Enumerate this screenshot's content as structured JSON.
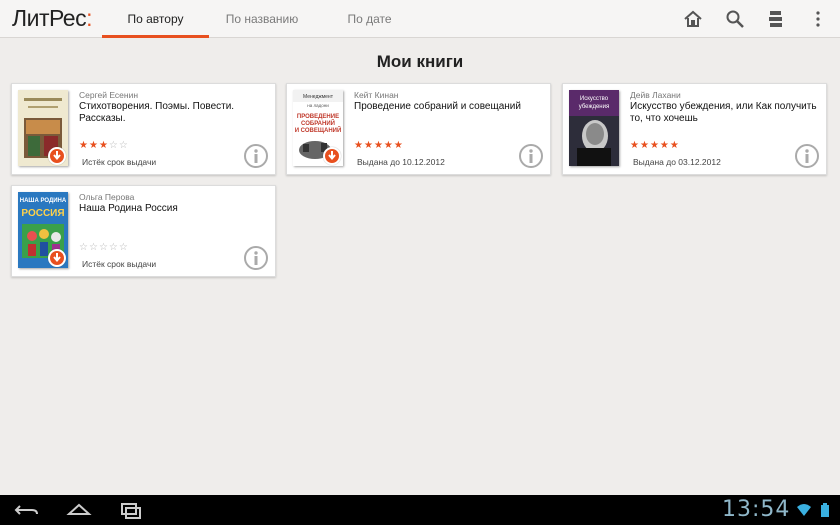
{
  "app": {
    "logo_main": "ЛитРес",
    "logo_colon": ":",
    "accent_color": "#e8501f"
  },
  "tabs": [
    {
      "label": "По автору",
      "active": true
    },
    {
      "label": "По названию",
      "active": false
    },
    {
      "label": "По дате",
      "active": false
    }
  ],
  "actions": {
    "home_icon": "home-icon",
    "search_icon": "search-icon",
    "shelf_icon": "bookshelf-icon",
    "overflow_icon": "overflow-menu-icon"
  },
  "page": {
    "title": "Мои книги"
  },
  "books": [
    {
      "author": "Сергей Есенин",
      "title": "Стихотворения. Поэмы. Повести. Рассказы.",
      "rating": 3,
      "status": "Истёк срок выдачи",
      "cover_color": "#e9e2c6"
    },
    {
      "author": "Кейт Кинан",
      "title": "Проведение собраний и совещаний",
      "rating": 5,
      "status": "Выдана до 10.12.2012",
      "cover_color": "#ffffff",
      "cover_lines": [
        "Менеджмент",
        "на ладони",
        "ПРОВЕДЕНИЕ",
        "СОБРАНИЙ",
        "И СОВЕЩАНИЙ"
      ]
    },
    {
      "author": "Дейв Лахани",
      "title": "Искусство убеждения, или Как получить то, что хочешь",
      "rating": 5,
      "status": "Выдана до 03.12.2012",
      "cover_color": "#3a2a4a",
      "cover_lines": [
        "Искусство",
        "убеждения"
      ]
    },
    {
      "author": "Ольга Перова",
      "title": "Наша Родина Россия",
      "rating": 0,
      "status": "Истёк срок выдачи",
      "cover_color": "#1d6fb8",
      "cover_lines": [
        "НАША РОДИНА",
        "РОССИЯ"
      ]
    }
  ],
  "system": {
    "clock": "13:54"
  }
}
